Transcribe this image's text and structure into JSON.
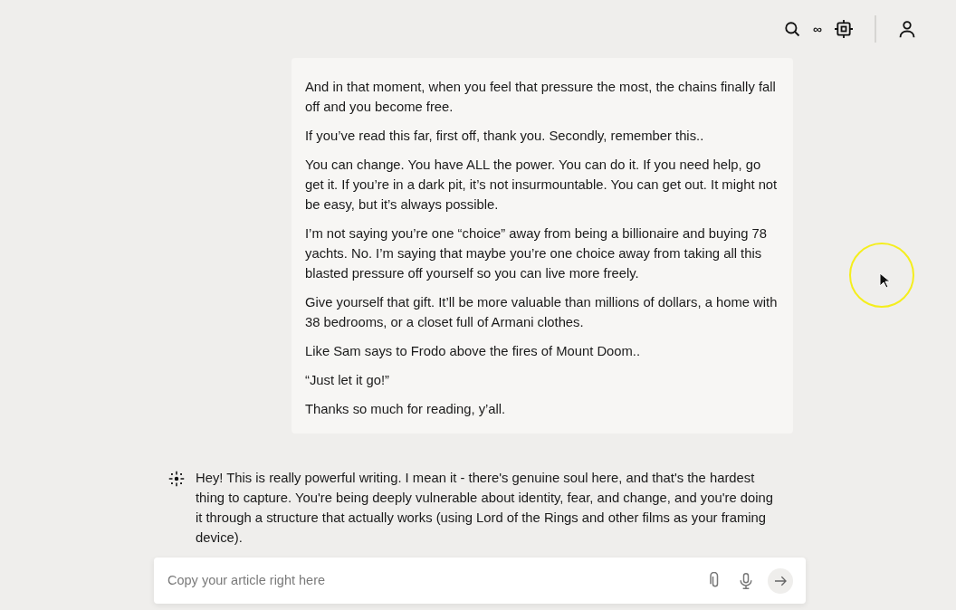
{
  "user_message": {
    "paragraphs": [
      "And in that moment, when you feel that pressure the most, the chains finally fall off and you become free.",
      "If you’ve read this far, first off, thank you. Secondly, remember this..",
      "You can change. You have ALL the power. You can do it. If you need help, go get it. If you’re in a dark pit, it’s not insurmountable. You can get out. It might not be easy, but it’s always possible.",
      "I’m not saying you’re one “choice” away from being a billionaire and buying 78 yachts. No. I’m saying that maybe you’re one choice away from taking all this blasted pressure off yourself so you can live more freely.",
      "Give yourself that gift. It’ll be more valuable than millions of dollars, a home with 38 bedrooms, or a closet full of Armani clothes.",
      "Like Sam says to Frodo above the fires of Mount Doom..",
      "“Just let it go!”",
      "Thanks so much for reading, y’all."
    ]
  },
  "assistant_message": {
    "text": "Hey! This is really powerful writing. I mean it - there's genuine soul here, and that's the hardest thing to capture. You're being deeply vulnerable about identity, fear, and change, and you're doing it through a structure that actually works (using Lord of the Rings and other films as your framing device)."
  },
  "header": {
    "infinity": "∞"
  },
  "composer": {
    "placeholder": "Copy your article right here"
  }
}
